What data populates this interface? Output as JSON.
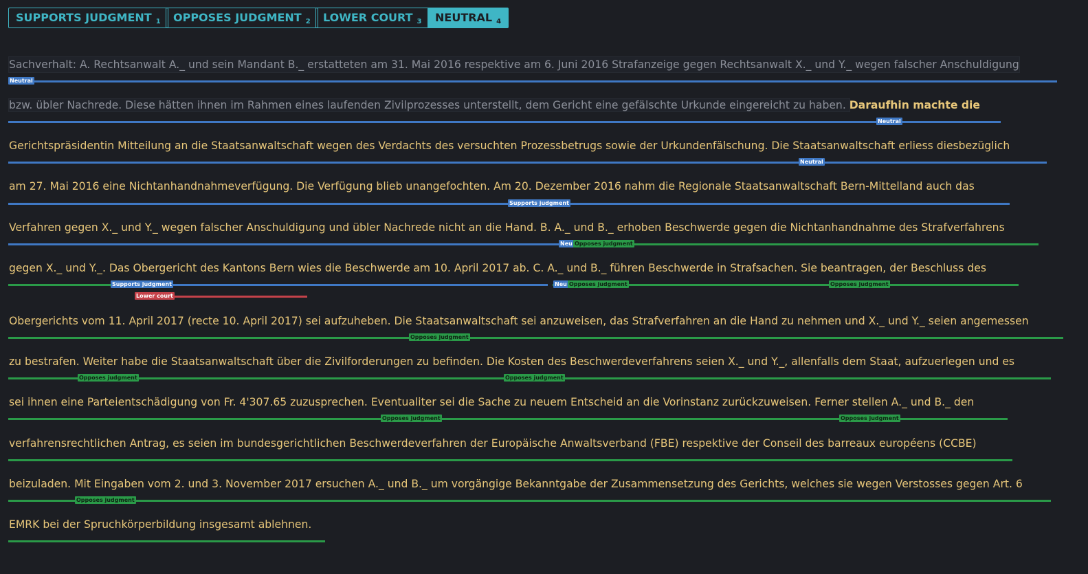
{
  "filters": [
    {
      "label": "SUPPORTS JUDGMENT",
      "count": "1"
    },
    {
      "label": "OPPOSES JUDGMENT",
      "count": "2"
    },
    {
      "label": "LOWER COURT",
      "count": "3"
    },
    {
      "label": "NEUTRAL",
      "count": "4"
    }
  ],
  "active_filter": "NEUTRAL",
  "lines": [
    "Sachverhalt: A. Rechtsanwalt A._ und sein Mandant B._ erstatteten am 31. Mai 2016 respektive am 6. Juni 2016 Strafanzeige gegen Rechtsanwalt X._ und Y._ wegen falscher Anschuldigung",
    {
      "dim": "bzw. übler Nachrede. Diese hätten ihnen im Rahmen eines laufenden Zivilprozesses unterstellt, dem Gericht eine gefälschte Urkunde eingereicht zu haben. ",
      "rest": "Daraufhin machte die"
    },
    "Gerichtspräsidentin Mitteilung an die Staatsanwaltschaft wegen des Verdachts des versuchten Prozessbetrugs sowie der Urkundenfälschung. Die Staatsanwaltschaft erliess diesbezüglich",
    "am 27. Mai 2016 eine Nichtanhandnahmeverfügung. Die Verfügung blieb unangefochten. Am 20. Dezember 2016 nahm die Regionale Staatsanwaltschaft Bern-Mittelland auch das",
    "Verfahren gegen X._ und Y._ wegen falscher Anschuldigung und übler Nachrede nicht an die Hand. B. A._ und B._ erhoben Beschwerde gegen die Nichtanhandnahme des Strafverfahrens",
    "gegen X._ und Y._. Das Obergericht des Kantons Bern wies die Beschwerde am 10. April 2017 ab. C. A._ und B._ führen Beschwerde in Strafsachen. Sie beantragen, der Beschluss des",
    "Obergerichts vom 11. April 2017 (recte 10. April 2017) sei aufzuheben. Die Staatsanwaltschaft sei anzuweisen, das Strafverfahren an die Hand zu nehmen und X._ und Y._ seien angemessen",
    "zu bestrafen. Weiter habe die Staatsanwaltschaft über die Zivilforderungen zu befinden. Die Kosten des Beschwerdeverfahrens seien X._ und Y._, allenfalls dem Staat, aufzuerlegen und es",
    "sei ihnen eine Parteientschädigung von Fr. 4'307.65 zuzusprechen. Eventualiter sei die Sache zu neuem Entscheid an die Vorinstanz zurückzuweisen. Ferner stellen A._ und B._ den",
    "verfahrensrechtlichen Antrag, es seien im bundesgerichtlichen Beschwerdeverfahren der Europäische Anwaltsverband (FBE) respektive der Conseil des barreaux européens (CCBE)",
    "beizuladen. Mit Eingaben vom 2. und 3. November 2017 ersuchen A._ und B._ um vorgängige Bekanntgabe der Zusammensetzung des Gerichts, welches sie wegen Verstosses gegen Art. 6",
    "EMRK bei der Spruchkörperbildung insgesamt ablehnen."
  ],
  "labels": {
    "neutral": "Neutral",
    "neutral_truncated": "Neu",
    "supports": "Supports judgment",
    "opposes": "Opposes judgment",
    "lower_court": "Lower court"
  },
  "colors": {
    "accent": "#3fb6c5",
    "neutral": "#3f78c4",
    "opposes": "#2a9a48",
    "lower_court": "#c4424a",
    "text": "#e8c77a",
    "text_dim": "#8b8f99",
    "background": "#1c1e23"
  }
}
